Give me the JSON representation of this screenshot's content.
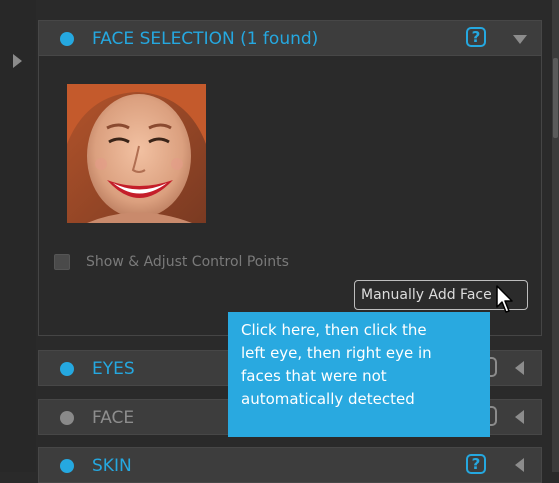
{
  "sidebar": {
    "collapse_icon": "triangle-right-icon"
  },
  "sections": {
    "face_selection": {
      "title": "FACE SELECTION (1 found)",
      "state": "enabled",
      "help": "?"
    },
    "eyes": {
      "title": "EYES",
      "state": "enabled"
    },
    "face": {
      "title": "FACE",
      "state": "disabled"
    },
    "skin": {
      "title": "SKIN",
      "state": "enabled",
      "help": "?"
    }
  },
  "face_panel": {
    "checkbox_label": "Show & Adjust Control Points",
    "checkbox_checked": false,
    "manual_button_label": "Manually Add Face"
  },
  "tooltip": {
    "text": "Click here, then click the\nleft eye, then right eye in\nfaces that were not\nautomatically detected"
  },
  "colors": {
    "accent": "#25a8e0",
    "panel": "#3d3d3d",
    "background": "#2a2a2a",
    "tooltip": "#29a9e0"
  }
}
